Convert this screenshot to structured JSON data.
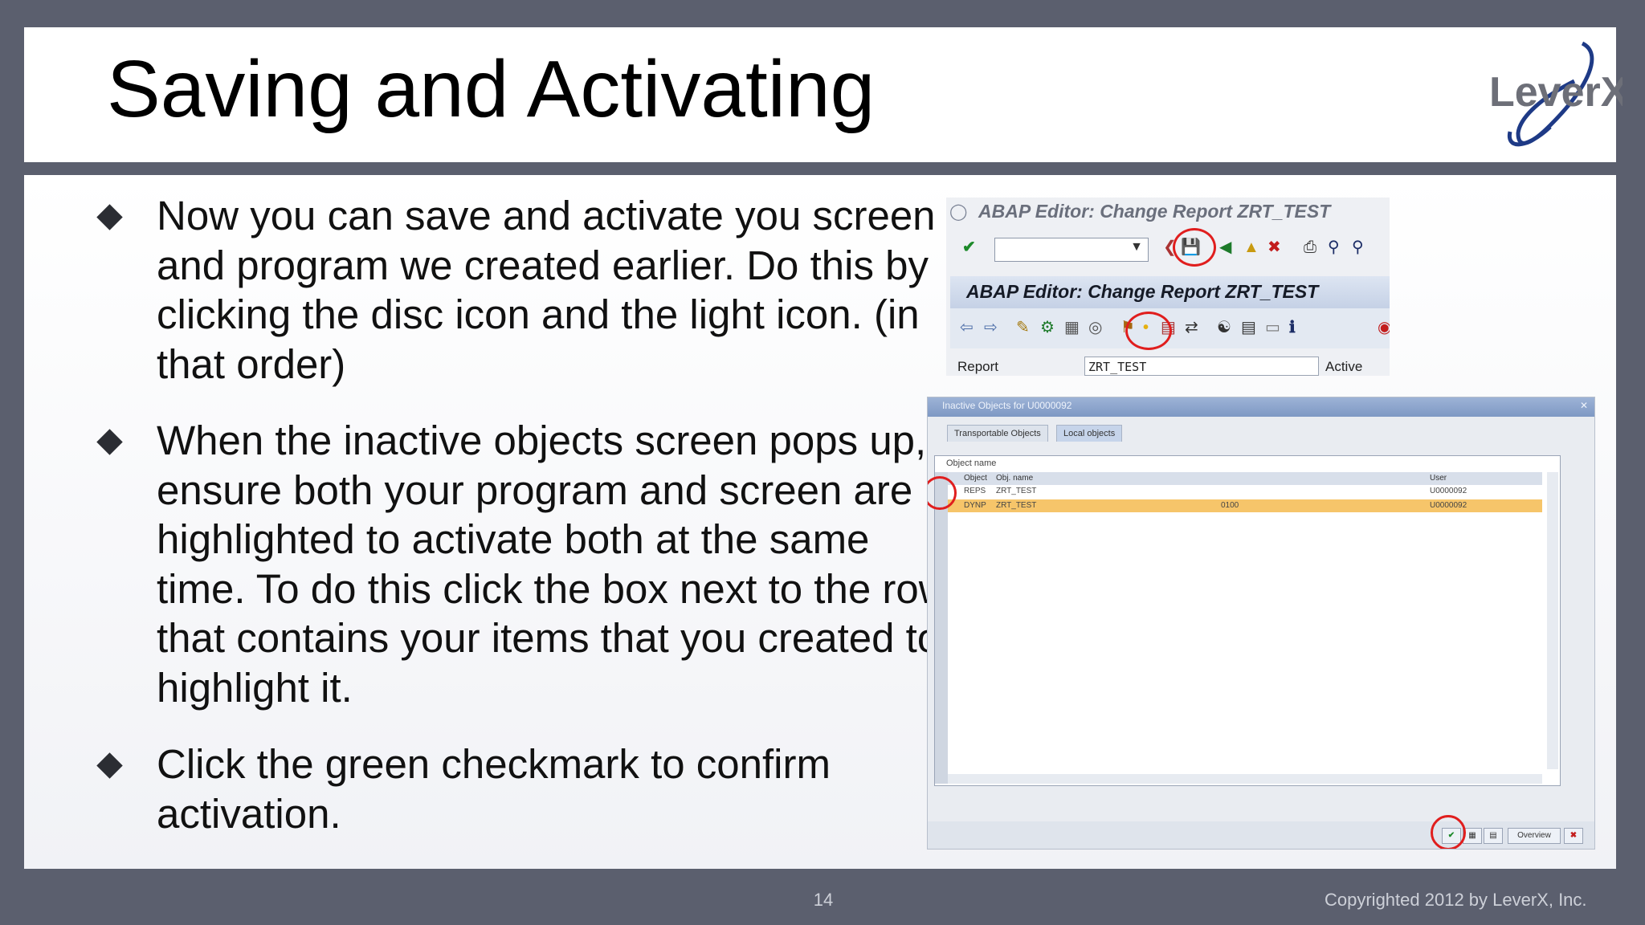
{
  "slide": {
    "title": "Saving and Activating",
    "logo_text": "LeverX",
    "page_number": "14",
    "copyright": "Copyrighted 2012 by LeverX, Inc.",
    "bullets": [
      "Now you can save and activate you screen and program we created earlier. Do this by clicking the disc icon and the light icon. (in that order)",
      "When the inactive objects screen pops up, ensure both your program and screen are highlighted to activate both at the same time. To do this click the box next to the row that contains your items that you created to highlight it.",
      "Click the green checkmark to confirm activation."
    ]
  },
  "sap_editor": {
    "window_title": "ABAP Editor: Change Report ZRT_TEST",
    "screen_title": "ABAP Editor: Change Report ZRT_TEST",
    "report_label": "Report",
    "report_value": "ZRT_TEST",
    "status": "Active",
    "toolbar_icons": [
      "enter-check-icon",
      "save-disc-icon",
      "back-icon",
      "exit-icon",
      "cancel-icon",
      "print-icon",
      "find-icon",
      "find-next-icon"
    ],
    "app_toolbar_icons": [
      "previous-icon",
      "next-icon",
      "display-change-icon",
      "other-object-icon",
      "check-icon",
      "activate-light-icon",
      "test-icon",
      "where-used-icon",
      "object-list-icon",
      "navigation-icon",
      "help-icon"
    ]
  },
  "inactive_objects": {
    "window_title": "Inactive Objects for U0000092",
    "tabs": [
      "Transportable Objects",
      "Local objects"
    ],
    "active_tab": "Local objects",
    "list_caption": "Object name",
    "columns": [
      "Object",
      "Obj. name",
      "User"
    ],
    "rows": [
      {
        "object": "REPS",
        "name": "ZRT_TEST",
        "extra": "",
        "user": "U0000092"
      },
      {
        "object": "DYNP",
        "name": "ZRT_TEST",
        "extra": "0100",
        "user": "U0000092"
      }
    ],
    "footer_overview": "Overview"
  },
  "colors": {
    "background": "#5b5f6e",
    "highlight_circle": "#e01e1e",
    "selected_row": "#f6c56a",
    "logo_blue": "#1e3a86"
  }
}
